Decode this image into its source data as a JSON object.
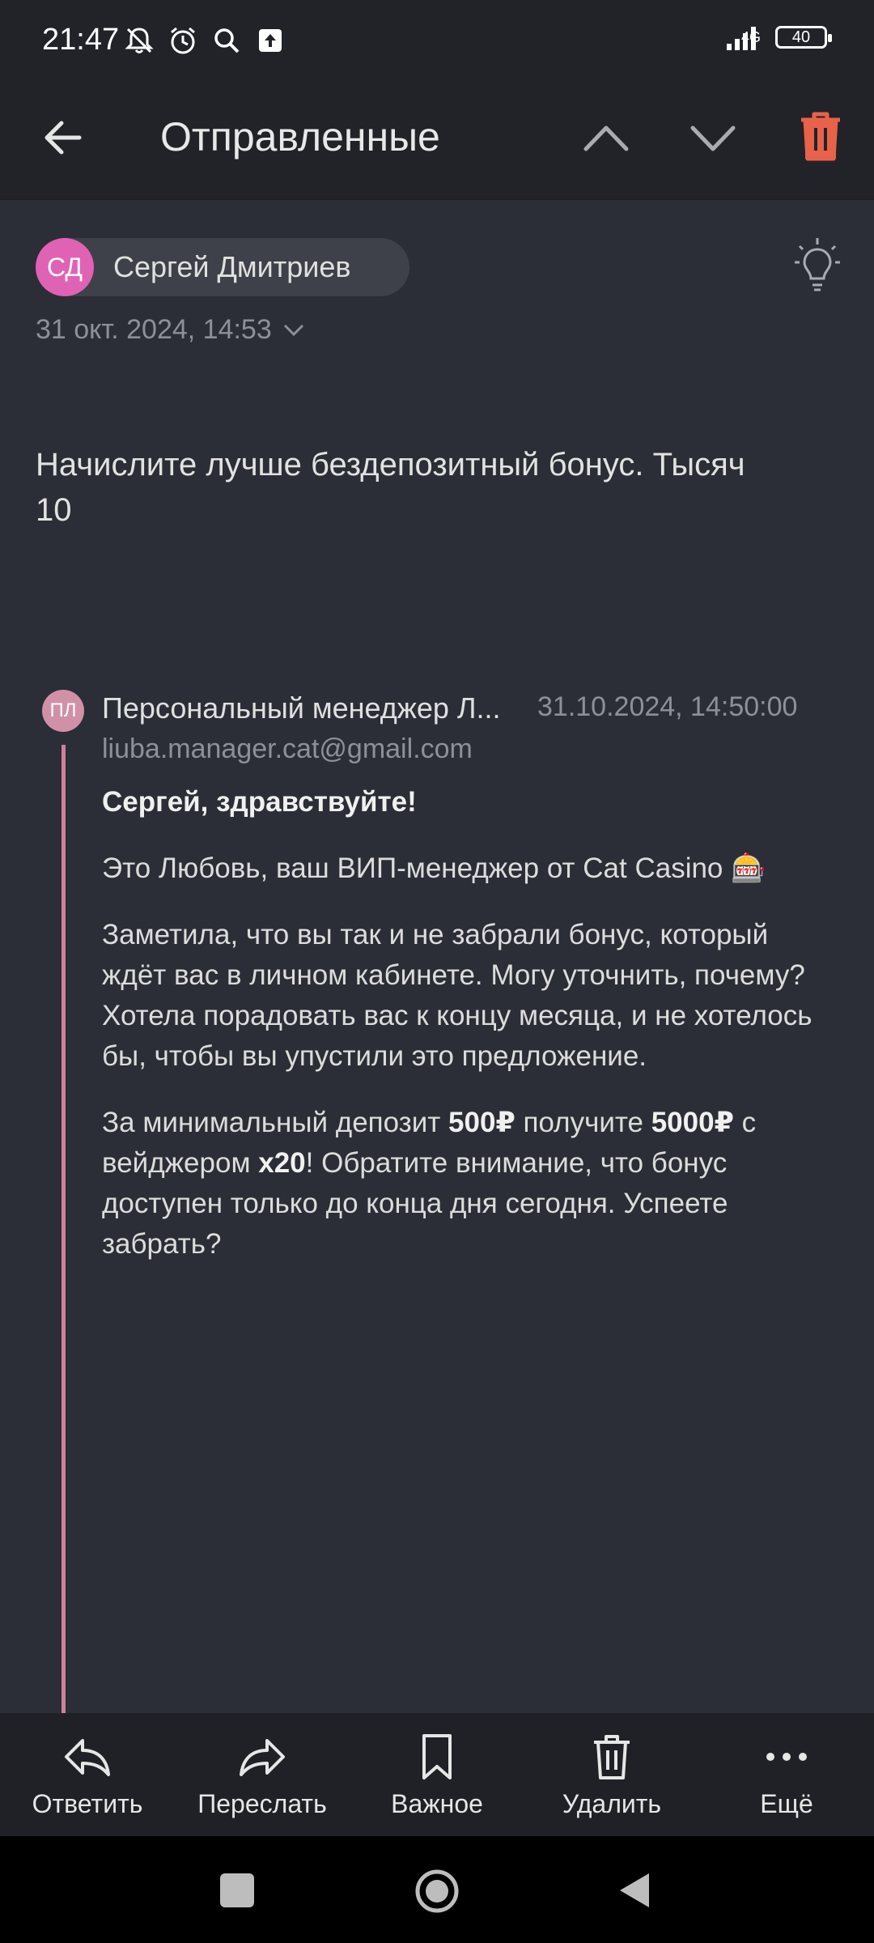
{
  "status_bar": {
    "time": "21:47",
    "network": "4G",
    "battery": "40"
  },
  "app_bar": {
    "title": "Отправленные"
  },
  "message": {
    "sender_initials": "СД",
    "sender_name": "Сергей Дмитриев",
    "date": "31 окт. 2024, 14:53",
    "body_line1": "Начислите лучше бездепозитный бонус. Тысяч",
    "body_line2": "10"
  },
  "quoted": {
    "avatar_initials": "ПЛ",
    "sender": "Персональный менеджер Л...",
    "date": "31.10.2024, 14:50:00",
    "email": "liuba.manager.cat@gmail.com",
    "greeting": "Сергей, здравствуйте!",
    "intro": "Это Любовь, ваш ВИП-менеджер от Cat Casino 🎰",
    "paragraph2": "Заметила, что вы так и не забрали бонус, который ждёт вас в личном кабинете. Могу уточнить, почему? Хотела порадовать вас к концу месяца, и не хотелось бы, чтобы вы упустили это предложение.",
    "p3_a": "За минимальный депозит ",
    "p3_b": "500₽",
    "p3_c": " получите ",
    "p3_d": "5000₽",
    "p3_e": " с вейджером ",
    "p3_f": "x20",
    "p3_g": "! Обратите внимание, что бонус доступен только до конца дня сегодня. Успеете забрать?"
  },
  "actions": {
    "reply": "Ответить",
    "forward": "Переслать",
    "important": "Важное",
    "delete": "Удалить",
    "more": "Ещё"
  },
  "colors": {
    "accent_delete": "#e8624a",
    "avatar_sender": "#e062b4",
    "avatar_quoted": "#d091a8",
    "quote_line": "#d27f9d"
  }
}
